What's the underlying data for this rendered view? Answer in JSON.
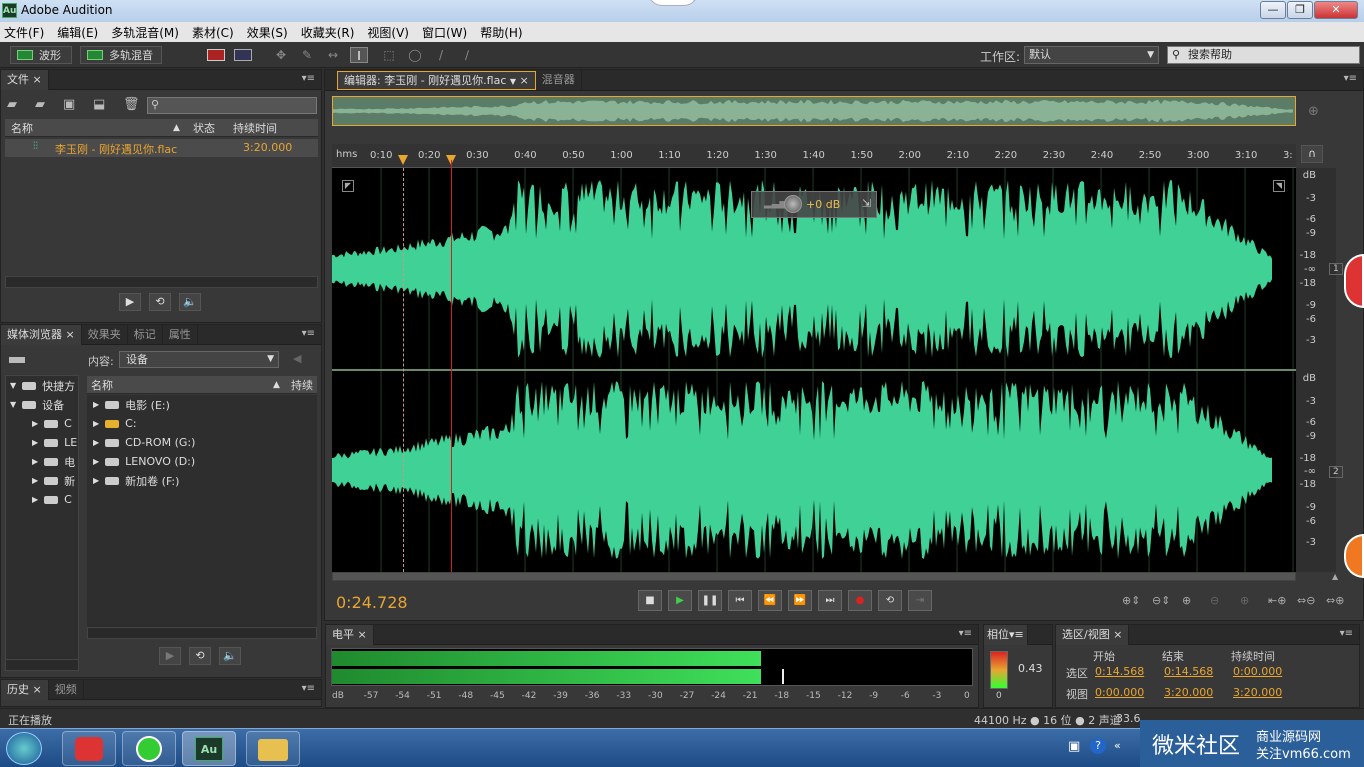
{
  "window": {
    "title": "Adobe Audition",
    "logo": "Au"
  },
  "menu": [
    "文件(F)",
    "编辑(E)",
    "多轨混音(M)",
    "素材(C)",
    "效果(S)",
    "收藏夹(R)",
    "视图(V)",
    "窗口(W)",
    "帮助(H)"
  ],
  "toolbar": {
    "waveform": "波形",
    "multitrack": "多轨混音",
    "workspace_label": "工作区:",
    "workspace_value": "默认",
    "search_placeholder": "搜索帮助"
  },
  "files_panel": {
    "tab": "文件",
    "columns": {
      "name": "名称",
      "status": "状态",
      "duration": "持续时间"
    },
    "items": [
      {
        "name": "李玉刚 - 刚好遇见你.flac",
        "duration": "3:20.000"
      }
    ]
  },
  "media_panel": {
    "tabs": [
      "媒体浏览器",
      "效果夹",
      "标记",
      "属性"
    ],
    "content_label": "内容:",
    "content_value": "设备",
    "left_tree": [
      "快捷方",
      "设备"
    ],
    "left_sub": [
      "C",
      "LE",
      "电",
      "新",
      "C"
    ],
    "columns": {
      "name": "名称",
      "duration": "持续"
    },
    "drives": [
      "电影 (E:)",
      "C:",
      "CD-ROM (G:)",
      "LENOVO (D:)",
      "新加卷 (F:)"
    ]
  },
  "history_panel": {
    "tabs": [
      "历史",
      "视频"
    ]
  },
  "editor": {
    "tabs": [
      "编辑器: 李玉刚 - 刚好遇见你.flac",
      "混音器"
    ],
    "ruler_unit": "hms",
    "ruler": [
      "0:10",
      "0:20",
      "0:30",
      "0:40",
      "0:50",
      "1:00",
      "1:10",
      "1:20",
      "1:30",
      "1:40",
      "1:50",
      "2:00",
      "2:10",
      "2:20",
      "2:30",
      "2:40",
      "2:50",
      "3:00",
      "3:10",
      "3:"
    ],
    "db_scale": [
      "dB",
      "-3",
      "-6",
      "-9",
      "-18",
      "-∞",
      "-18",
      "-9",
      "-6",
      "-3"
    ],
    "channels": [
      "1",
      "2"
    ],
    "hud_gain": "+0 dB",
    "time": "0:24.728"
  },
  "level_meter": {
    "tab": "电平",
    "scale": [
      "dB",
      "-57",
      "-54",
      "-51",
      "-48",
      "-45",
      "-42",
      "-39",
      "-36",
      "-33",
      "-30",
      "-27",
      "-24",
      "-21",
      "-18",
      "-15",
      "-12",
      "-9",
      "-6",
      "-3",
      "0"
    ],
    "left_level": 0.67,
    "right_level": 0.67
  },
  "phase_panel": {
    "tab": "相位",
    "value": "0.43",
    "zero": "0"
  },
  "selection_panel": {
    "tab": "选区/视图",
    "headers": {
      "start": "开始",
      "end": "结束",
      "duration": "持续时间"
    },
    "selection": {
      "label": "选区",
      "start": "0:14.568",
      "end": "0:14.568",
      "duration": "0:00.000"
    },
    "view": {
      "label": "视图",
      "start": "0:00.000",
      "end": "3:20.000",
      "duration": "3:20.000"
    }
  },
  "status": {
    "left": "正在播放",
    "format": "44100 Hz ● 16 位 ● 2 声道",
    "extra": "33.6"
  },
  "watermark": {
    "brand": "微米社区",
    "line1": "商业源码网",
    "line2": "关注vm66.com"
  },
  "colors": {
    "wave": "#3fd196",
    "accent": "#e8a530",
    "playhead": "#cc2222"
  }
}
